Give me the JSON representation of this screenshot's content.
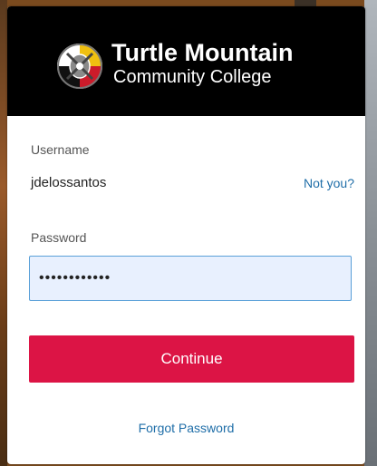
{
  "brand": {
    "title": "Turtle Mountain",
    "subtitle": "Community College"
  },
  "form": {
    "username_label": "Username",
    "username_value": "jdelossantos",
    "not_you_label": "Not you?",
    "password_label": "Password",
    "password_value": "••••••••••••",
    "continue_label": "Continue",
    "forgot_label": "Forgot Password"
  },
  "colors": {
    "header_bg": "#000000",
    "button_bg": "#dc1445",
    "link": "#1f6ea8",
    "input_bg": "#e8f0fe",
    "input_border": "#5aa0d8"
  }
}
